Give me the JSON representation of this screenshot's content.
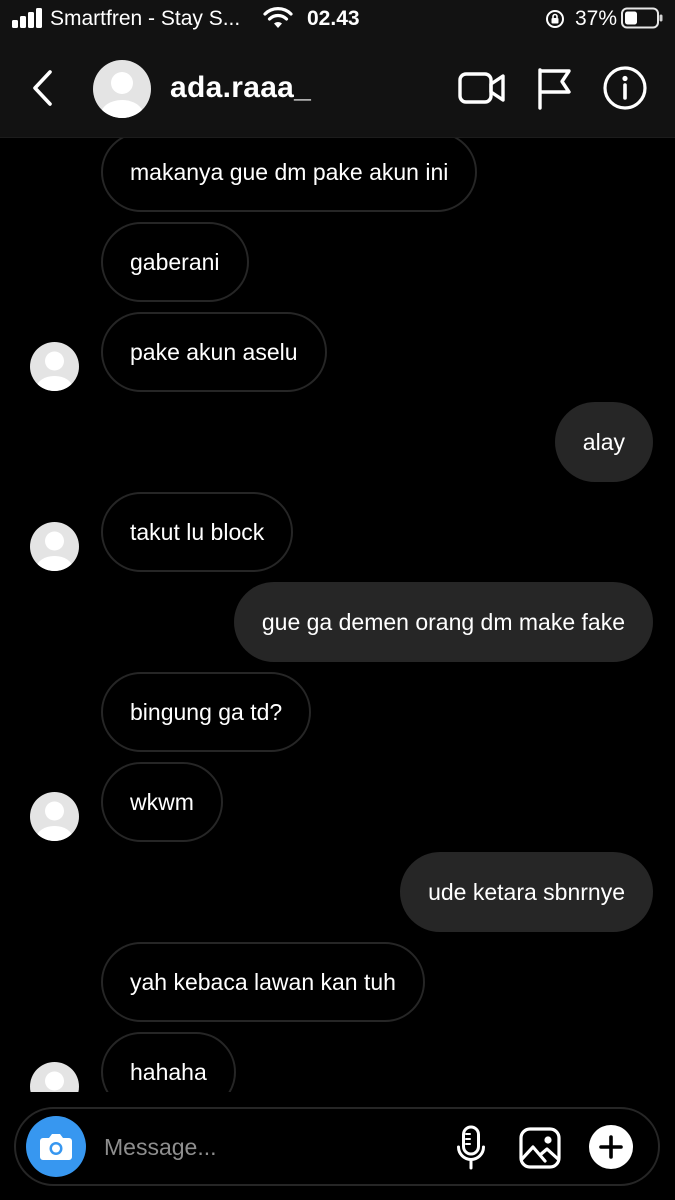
{
  "status_bar": {
    "carrier": "Smartfren - Stay S...",
    "time": "02.43",
    "battery": "37%"
  },
  "header": {
    "username": "ada.raaa_",
    "icons": [
      "back-icon",
      "video-call-icon",
      "flag-icon",
      "info-icon"
    ]
  },
  "messages": [
    {
      "from": "them",
      "text": "makanya gue dm pake akun ini"
    },
    {
      "from": "them",
      "text": "gaberani"
    },
    {
      "from": "them",
      "text": "pake akun aselu",
      "avatar": true
    },
    {
      "from": "me",
      "text": "alay"
    },
    {
      "from": "them",
      "text": "takut lu block",
      "avatar": true
    },
    {
      "from": "me",
      "text": "gue ga demen orang dm make fake"
    },
    {
      "from": "them",
      "text": "bingung ga td?"
    },
    {
      "from": "them",
      "text": "wkwm",
      "avatar": true
    },
    {
      "from": "me",
      "text": "ude ketara sbnrnye"
    },
    {
      "from": "them",
      "text": "yah kebaca lawan kan tuh"
    },
    {
      "from": "them",
      "text": "hahaha",
      "avatar": true
    }
  ],
  "composer": {
    "placeholder": "Message...",
    "icons": [
      "camera-icon",
      "microphone-icon",
      "gallery-icon",
      "plus-icon"
    ]
  },
  "colors": {
    "background": "#000000",
    "bar": "#121212",
    "outgoing_bubble": "#262626",
    "incoming_border": "#262626",
    "camera_button": "#3797f0",
    "placeholder": "#8e8e8e"
  }
}
